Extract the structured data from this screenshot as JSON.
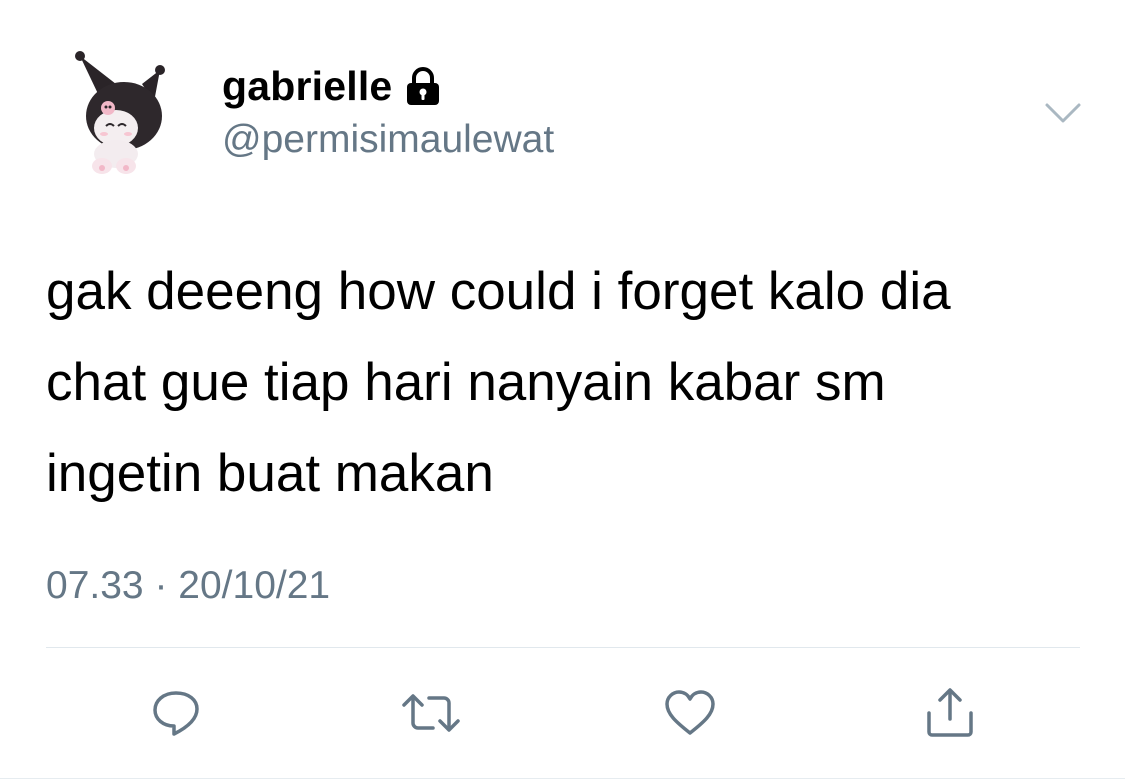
{
  "user": {
    "display_name": "gabrielle",
    "handle": "@permisimaulewat",
    "avatar_icon": "kuromi-avatar",
    "protected_icon": "lock-icon"
  },
  "tweet": {
    "lines": [
      "gak deeeng how could i forget kalo dia",
      "chat gue tiap hari nanyain kabar sm",
      "ingetin buat makan"
    ],
    "time": "07.33",
    "separator": "·",
    "date": "20/10/21"
  },
  "actions": {
    "reply_icon": "reply-icon",
    "retweet_icon": "retweet-icon",
    "like_icon": "heart-icon",
    "share_icon": "share-icon",
    "menu_icon": "chevron-down-icon"
  },
  "colors": {
    "text": "#000000",
    "secondary": "#657786",
    "icon": "#657786",
    "divider": "#e1e8ed",
    "background": "#ffffff"
  }
}
